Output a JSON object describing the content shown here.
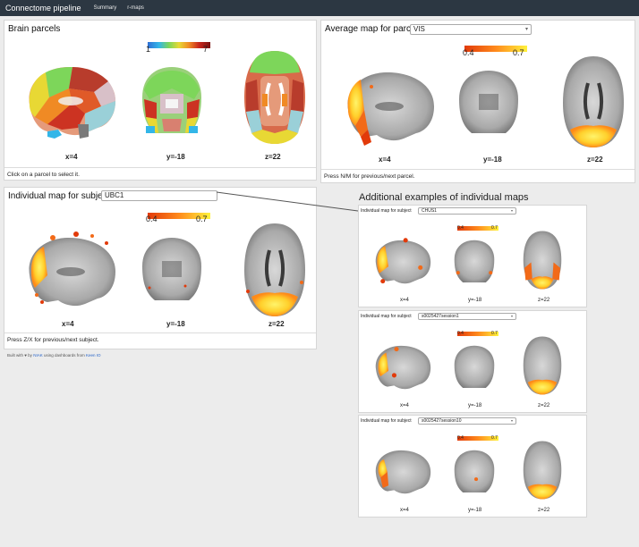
{
  "navbar": {
    "brand": "Connectome pipeline",
    "links": [
      "Summary",
      "r-maps"
    ]
  },
  "parcels": {
    "title": "Brain parcels",
    "cbar_min": "1",
    "cbar_max": "7",
    "coords": [
      "x=4",
      "y=-18",
      "z=22"
    ],
    "footer": "Click on a parcel to select it."
  },
  "average": {
    "title": "Average map for parcel",
    "select_value": "VIS",
    "cbar_min": "0.4",
    "cbar_max": "0.7",
    "coords": [
      "x=4",
      "y=-18",
      "z=22"
    ],
    "footer": "Press N/M for previous/next parcel."
  },
  "individual": {
    "title": "Individual map for subject",
    "select_value": "UBC1",
    "cbar_min": "0.4",
    "cbar_max": "0.7",
    "coords": [
      "x=4",
      "y=-18",
      "z=22"
    ],
    "footer": "Press Z/X for previous/next subject."
  },
  "built_with": {
    "prefix": "Built with ♥ by",
    "author": "NIAK",
    "middle": "using dashboards from",
    "source": "Keen IO"
  },
  "examples": {
    "title": "Additional examples of individual maps",
    "label": "Individual map for subject",
    "items": [
      {
        "select_value": "CHUS1",
        "cbar_min": "0.4",
        "cbar_max": "0.7",
        "coords": [
          "x=4",
          "y=-18",
          "z=22"
        ]
      },
      {
        "select_value": "s0025427session1",
        "cbar_min": "0.4",
        "cbar_max": "0.7",
        "coords": [
          "x=4",
          "y=-18",
          "z=22"
        ]
      },
      {
        "select_value": "s0025427session10",
        "cbar_min": "0.4",
        "cbar_max": "0.7",
        "coords": [
          "x=4",
          "y=-18",
          "z=22"
        ]
      }
    ]
  },
  "colors": {
    "navbar": "#2c3742",
    "heat_low": "#e8400c",
    "heat_high": "#ffee40",
    "link": "#2a66c9"
  }
}
